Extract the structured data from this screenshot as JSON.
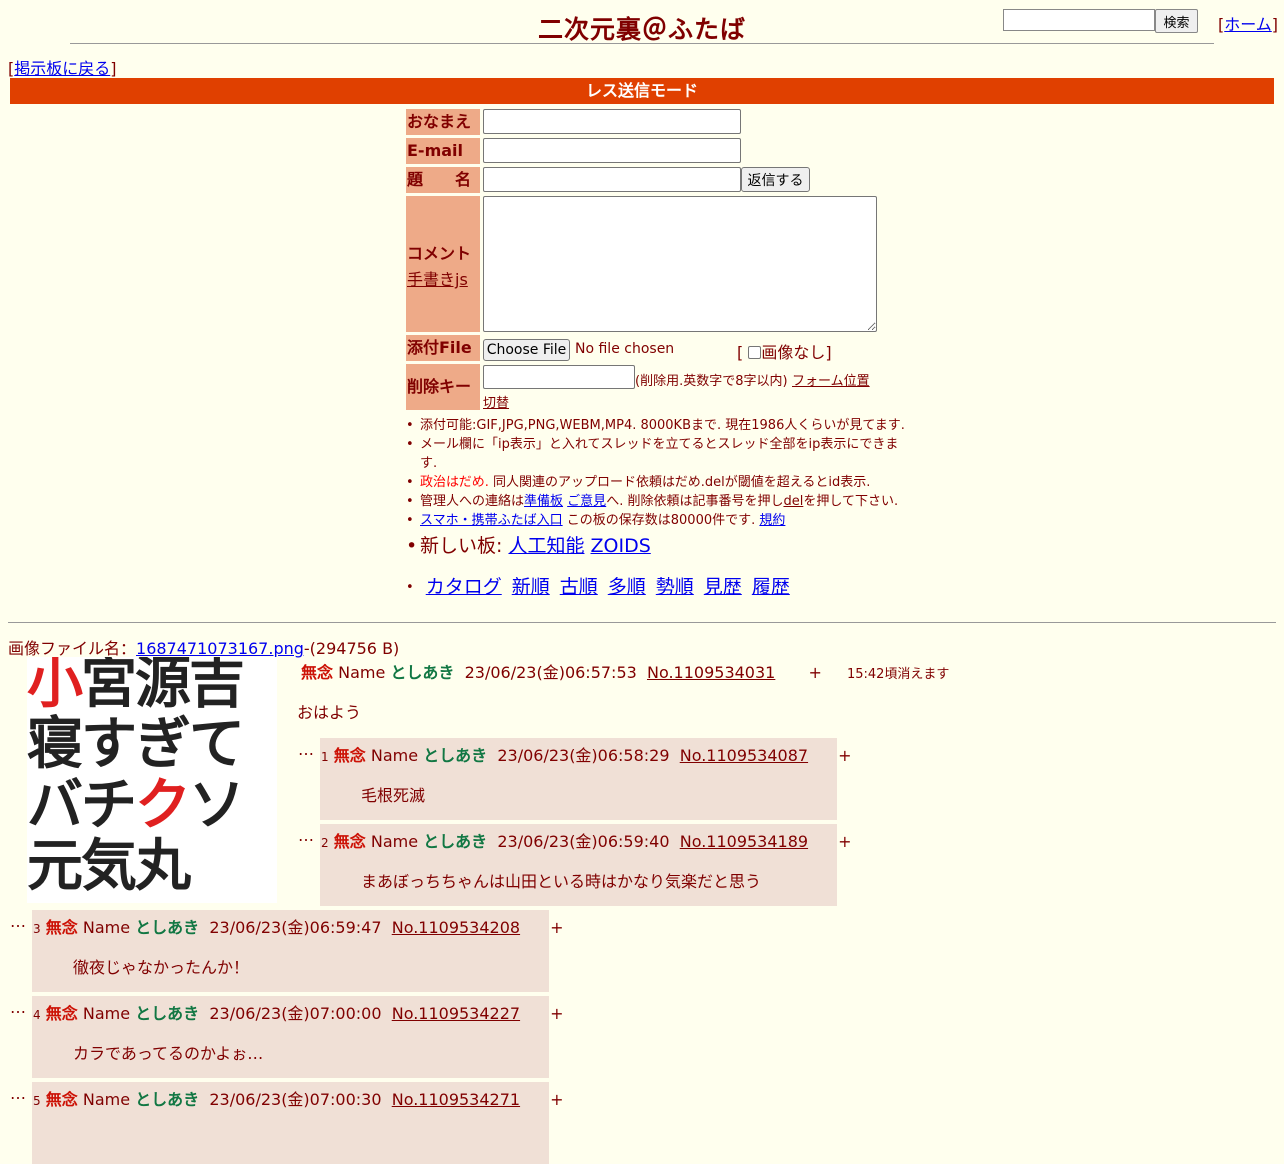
{
  "header": {
    "title": "二次元裏＠ふたば",
    "search_placeholder": "",
    "search_label": "検索",
    "home_label": "ホーム",
    "back_label": "掲示板に戻る"
  },
  "form": {
    "mode_banner": "レス送信モード",
    "name_label": "おなまえ",
    "email_label": "E-mail",
    "subject_label": "題　　名",
    "submit_label": "返信する",
    "comment_label": "コメント",
    "tegaki_label": "手書きjs",
    "file_label": "添付File",
    "choose_file": "Choose File",
    "no_file": "No file chosen",
    "no_image_label": "画像なし",
    "delkey_label": "削除キー",
    "delkey_note": "(削除用.英数字で8字以内)",
    "form_position_link": "フォーム位置切替"
  },
  "notes": {
    "n1": "添付可能:GIF,JPG,PNG,WEBM,MP4. 8000KBまで. 現在1986人くらいが見てます.",
    "n2": "メール欄に「ip表示」と入れてスレッドを立てるとスレッド全部をip表示にできます.",
    "n3_red": "政治はだめ.",
    "n3_rest": " 同人関連のアップロード依頼はだめ.delが閾値を超えるとid表示.",
    "n4_a": "管理人への連絡は",
    "n4_link1": "準備板",
    "n4_link2": "ご意見",
    "n4_b": "へ. 削除依頼は記事番号を押し",
    "n4_link3": "del",
    "n4_c": "を押して下さい.",
    "n5_link": "スマホ・携帯ふたば入口",
    "n5_text": " この板の保存数は80000件です.",
    "n5_link2": "規約",
    "new_boards_label": "新しい板:",
    "new_board_1": "人工知能",
    "new_board_2": "ZOIDS",
    "nav": [
      "カタログ",
      "新順",
      "古順",
      "多順",
      "勢順",
      "見歴",
      "履歴"
    ]
  },
  "thread": {
    "file_label": "画像ファイル名：",
    "file_name": "1687471073167.png",
    "file_size": "-(294756 B)",
    "image_lines": [
      "小宮源吉",
      "寝すぎて",
      "バチクソ",
      "元気丸"
    ],
    "subject": "無念",
    "name_word": "Name",
    "name": "としあき",
    "date": "23/06/23(金)06:57:53",
    "no": "No.1109534031",
    "plus": "+",
    "expire": "15:42頃消えます",
    "body": "おはよう"
  },
  "replies": [
    {
      "num": "1",
      "subject": "無念",
      "name_word": "Name",
      "name": "としあき",
      "date": "23/06/23(金)06:58:29",
      "no": "No.1109534087",
      "plus": "+",
      "body": "毛根死滅"
    },
    {
      "num": "2",
      "subject": "無念",
      "name_word": "Name",
      "name": "としあき",
      "date": "23/06/23(金)06:59:40",
      "no": "No.1109534189",
      "plus": "+",
      "body": "まあぼっちちゃんは山田といる時はかなり気楽だと思う"
    },
    {
      "num": "3",
      "subject": "無念",
      "name_word": "Name",
      "name": "としあき",
      "date": "23/06/23(金)06:59:47",
      "no": "No.1109534208",
      "plus": "+",
      "body": "徹夜じゃなかったんか！"
    },
    {
      "num": "4",
      "subject": "無念",
      "name_word": "Name",
      "name": "としあき",
      "date": "23/06/23(金)07:00:00",
      "no": "No.1109534227",
      "plus": "+",
      "body": "カラであってるのかよぉ…"
    },
    {
      "num": "5",
      "subject": "無念",
      "name_word": "Name",
      "name": "としあき",
      "date": "23/06/23(金)07:00:30",
      "no": "No.1109534271",
      "plus": "+",
      "body": ""
    }
  ],
  "ellipsis": "…",
  "colors": {
    "background": "#ffffee",
    "banner": "#e04000",
    "label_bg": "#eeaa88",
    "reply_bg": "#f0e0d6",
    "subject": "#cc1105",
    "name": "#117743"
  }
}
